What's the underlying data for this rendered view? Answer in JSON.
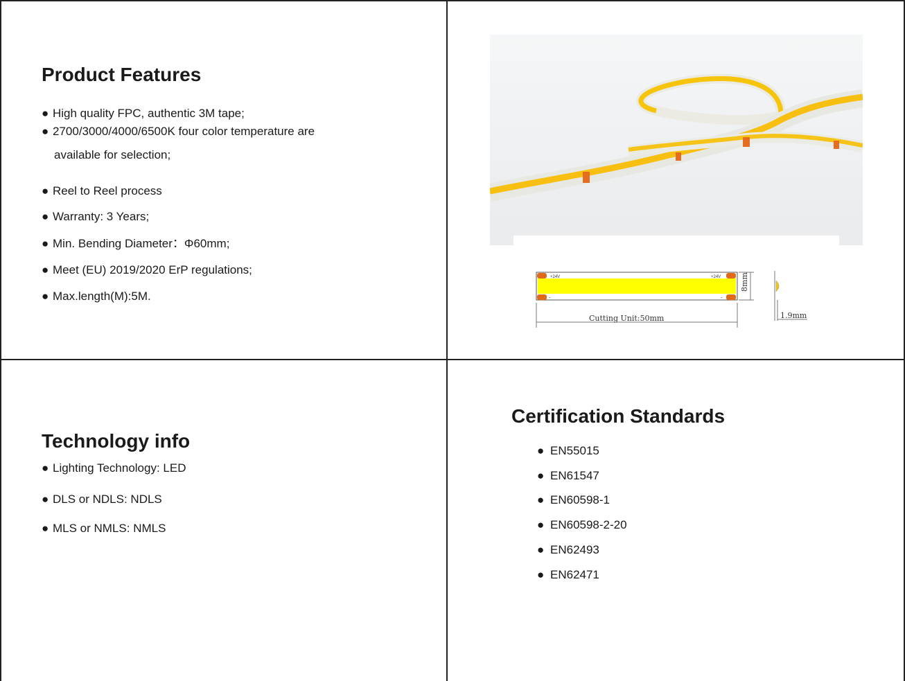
{
  "product_features": {
    "title": "Product Features",
    "items": [
      "High quality FPC, authentic 3M tape;",
      "2700/3000/4000/6500K four color temperature are",
      "available for selection;",
      "Reel to Reel process",
      "Warranty: 3 Years;",
      "Min. Bending Diameter：Φ60mm;",
      "Meet (EU) 2019/2020 ErP regulations;",
      "Max.length(M):5M."
    ]
  },
  "technology_info": {
    "title": "Technology info",
    "items": [
      "Lighting Technology: LED",
      "DLS or NDLS: NDLS",
      "MLS or NMLS: NMLS"
    ]
  },
  "certification": {
    "title": "Certification Standards",
    "items": [
      "EN55015",
      "EN61547",
      "EN60598-1",
      "EN60598-2-20",
      "EN62493",
      "EN62471"
    ]
  },
  "diagram": {
    "label_plus_left": "+24V",
    "label_plus_right": "+24V",
    "label_minus_left": "-",
    "label_minus_right": "-",
    "cutting_unit": "Cutting Unit:50mm",
    "width": "8mm",
    "thickness": "1.9mm",
    "strip_color": "#ffff00",
    "pad_color": "#e06a1b"
  },
  "bullet": "●"
}
